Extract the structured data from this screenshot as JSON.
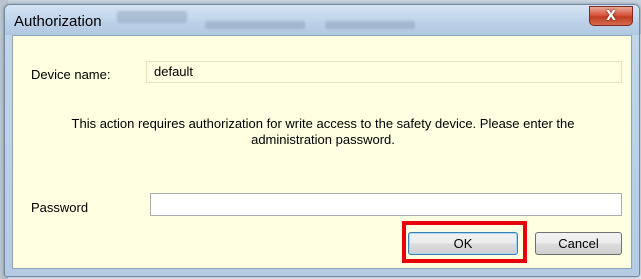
{
  "window": {
    "title": "Authorization",
    "close_glyph": "X"
  },
  "form": {
    "device_name_label": "Device name:",
    "device_name_value": "default",
    "message_line1": "This action requires authorization for write access to the safety device. Please enter the",
    "message_line2": "administration password.",
    "password_label": "Password",
    "password_value": ""
  },
  "buttons": {
    "ok_label": "OK",
    "cancel_label": "Cancel"
  },
  "colors": {
    "client_background": "#ffffe1",
    "highlight": "#e8000b",
    "close_button": "#c23d22"
  },
  "icons": {
    "close": "close-icon"
  }
}
